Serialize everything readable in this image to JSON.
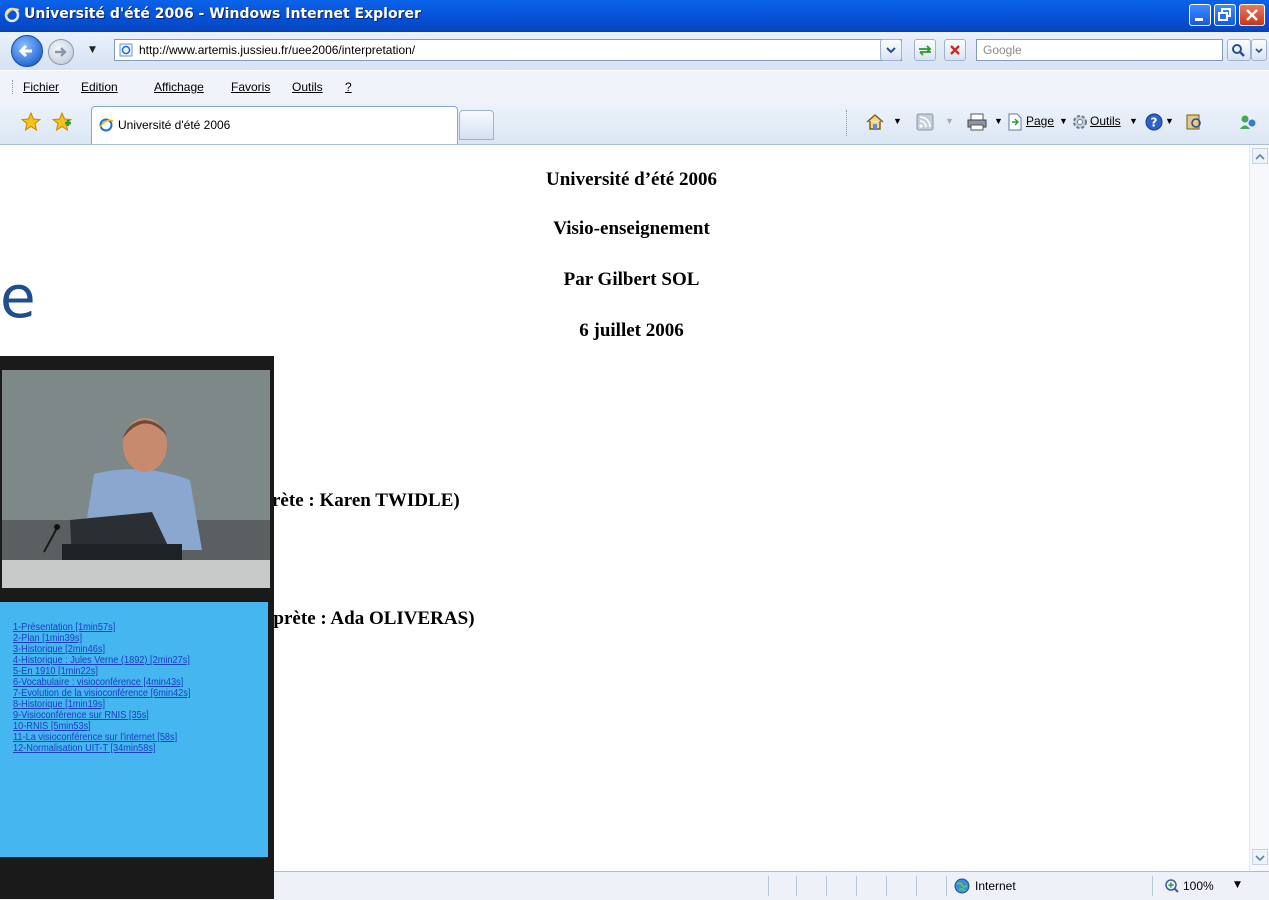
{
  "window": {
    "title": "Université d'été 2006 - Windows Internet Explorer"
  },
  "address": {
    "url": "http://www.artemis.jussieu.fr/uee2006/interpretation/",
    "search_placeholder": "Google"
  },
  "menu": {
    "items": [
      "Fichier",
      "Edition",
      "Affichage",
      "Favoris",
      "Outils",
      "?"
    ]
  },
  "tab": {
    "title": "Université d'été 2006"
  },
  "commandbar": {
    "page_label": "Page",
    "tools_label": "Outils"
  },
  "content": {
    "lines": [
      "Université d’été 2006",
      "Visio-enseignement",
      "Par Gilbert SOL",
      "6 juillet 2006"
    ],
    "partial_line_1": "rète : Karen TWIDLE)",
    "partial_line_2": "rprète : Ada OLIVERAS)"
  },
  "status": {
    "zone": "Internet",
    "zoom": "100%"
  },
  "overlay": {
    "slide_fragment": "e",
    "video_links": [
      "1-Présentation [1min57s]",
      "2-Plan [1min39s]",
      "3-Historique [2min46s]",
      "4-Historique : Jules Verne (1892) [2min27s]",
      "5-En 1910 [1min22s]",
      "6-Vocabulaire : visioconférence [4min43s]",
      "7-Evolution de la visioconférence [6min42s]",
      "8-Historique [1min19s]",
      "9-Visioconférence sur RNIS [35s]",
      "10-RNIS [5min53s]",
      "11-La visioconférence sur l'internet [58s]",
      "12-Normalisation UIT-T [34min58s]"
    ]
  },
  "colors": {
    "titlebar": "#0855dd",
    "panel": "#45b6f0",
    "link": "#1d3fbe"
  }
}
